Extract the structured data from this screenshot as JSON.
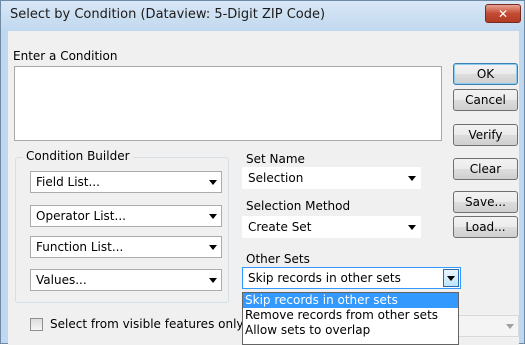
{
  "window": {
    "title": "Select by Condition (Dataview: 5-Digit ZIP Code)",
    "close_glyph": "✕"
  },
  "condition": {
    "label": "Enter a Condition",
    "value": ""
  },
  "buttons": {
    "ok": "OK",
    "cancel": "Cancel",
    "verify": "Verify",
    "clear": "Clear",
    "save": "Save...",
    "load": "Load..."
  },
  "builder": {
    "title": "Condition Builder",
    "field_list": "Field List...",
    "operator_list": "Operator List...",
    "function_list": "Function List...",
    "values": "Values..."
  },
  "set_name": {
    "label": "Set Name",
    "value": "Selection"
  },
  "selection_method": {
    "label": "Selection Method",
    "value": "Create Set"
  },
  "other_sets": {
    "label": "Other Sets",
    "value": "Skip records in other sets",
    "options": [
      "Skip records in other sets",
      "Remove records from other sets",
      "Allow sets to overlap"
    ],
    "selected_index": 0
  },
  "visible_only": {
    "label": "Select from visible features only",
    "checked": false
  },
  "colors": {
    "accent": "#3399ff",
    "close": "#c44b34"
  }
}
